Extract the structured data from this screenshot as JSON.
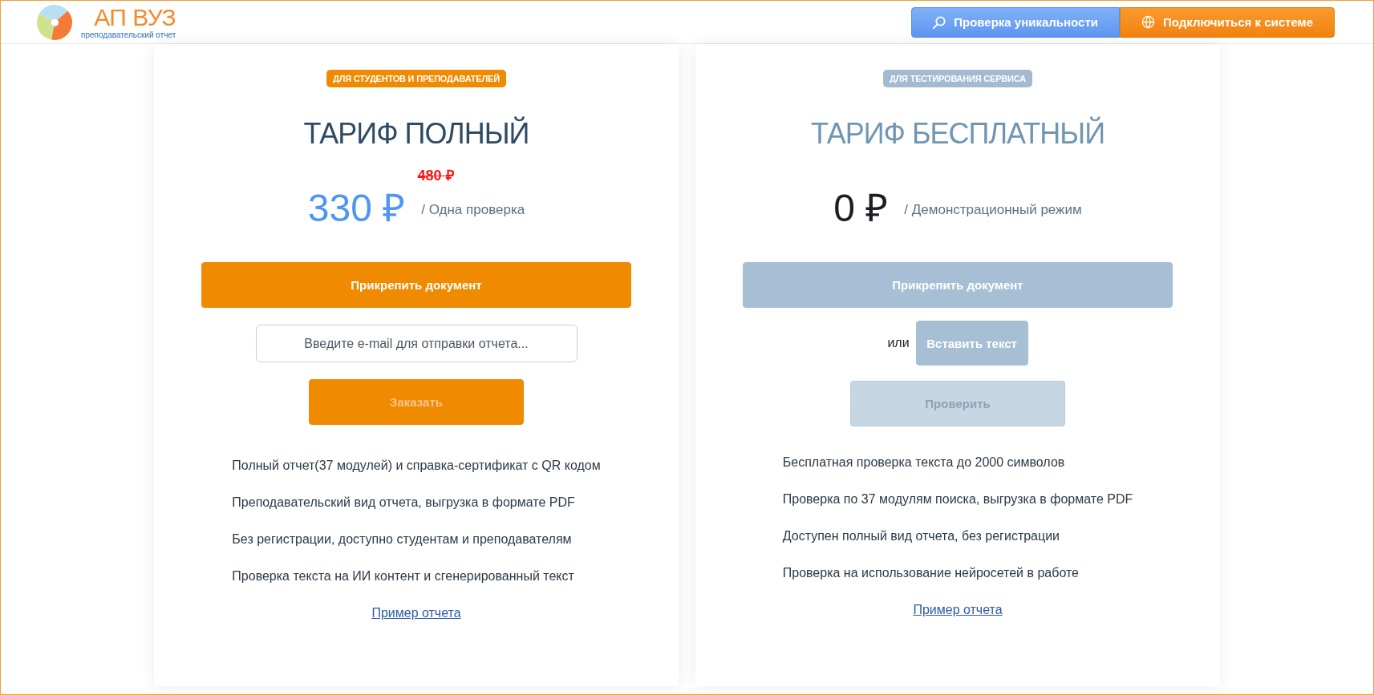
{
  "header": {
    "logo": {
      "title": "АП ВУЗ",
      "subtitle": "преподавательский отчет"
    },
    "buttons": [
      {
        "kind": "check",
        "label": "Проверка уникальности"
      },
      {
        "kind": "connect",
        "label": "Подключиться к системе"
      }
    ]
  },
  "plans": [
    {
      "kind": "paid",
      "badge": "ДЛЯ СТУДЕНТОВ И ПРЕПОДАВАТЕЛЕЙ",
      "title": "ТАРИФ ПОЛНЫЙ",
      "old_price": "480 ₽",
      "price": "330 ₽",
      "price_note": "/ Одна проверка",
      "actions": [
        {
          "kind": "button",
          "label": "Прикрепить документ",
          "disabled": false
        },
        {
          "kind": "input",
          "placeholder": "Введите e-mail для отправки отчета..."
        },
        {
          "kind": "button",
          "label": "Заказать",
          "disabled": true
        }
      ],
      "features": [
        "Полный отчет(37 модулей) и справка-сертификат с QR кодом",
        "Преподавательский вид отчета, выгрузка в формате PDF",
        "Без регистрации, доступно студентам и преподавателям",
        "Проверка текста на ИИ контент и сгенерированный текст"
      ],
      "link": "Пример отчета"
    },
    {
      "kind": "free",
      "badge": "ДЛЯ ТЕСТИРОВАНИЯ СЕРВИСА",
      "title": "ТАРИФ БЕСПЛАТНЫЙ",
      "price": "0 ₽",
      "price_note": "/ Демонстрационный режим",
      "actions": [
        {
          "kind": "button",
          "label": "Прикрепить документ",
          "disabled": false
        },
        {
          "kind": "or_button",
          "text": "или",
          "label": "Вставить текст",
          "disabled": false
        },
        {
          "kind": "button",
          "label": "Проверить",
          "disabled": true
        }
      ],
      "features": [
        "Бесплатная проверка текста до 2000 символов",
        "Проверка по 37 модулям поиска, выгрузка в формате PDF",
        "Доступен полный вид отчета, без регистрации",
        "Проверка на использование нейросетей в работе"
      ],
      "link": "Пример отчета"
    }
  ]
}
